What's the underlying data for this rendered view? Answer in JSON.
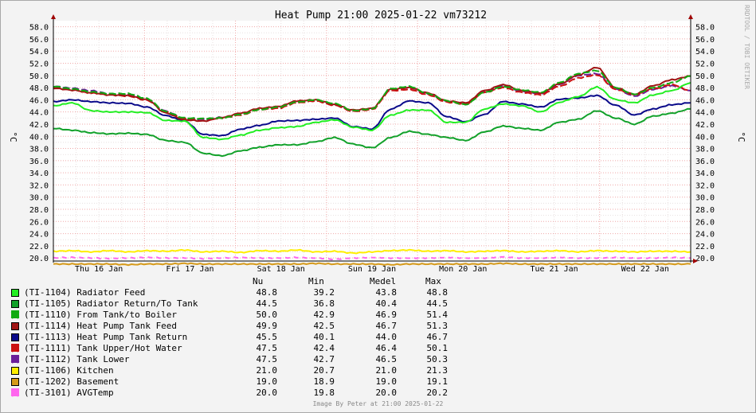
{
  "chart_data": {
    "type": "line",
    "title": "Heat Pump 21:00 2025-01-22 vm73212",
    "ylabel": "°C",
    "ylabel_right": "°C",
    "ylim": [
      19.5,
      59
    ],
    "y_ticks": [
      "58.0",
      "56.0",
      "54.0",
      "52.0",
      "50.0",
      "48.0",
      "46.0",
      "44.0",
      "42.0",
      "40.0",
      "38.0",
      "36.0",
      "34.0",
      "32.0",
      "30.0",
      "28.0",
      "26.0",
      "24.0",
      "22.0",
      "20.0"
    ],
    "x_ticks": [
      "Thu 16 Jan",
      "Fri 17 Jan",
      "Sat 18 Jan",
      "Sun 19 Jan",
      "Mon 20 Jan",
      "Tue 21 Jan",
      "Wed 22 Jan"
    ],
    "grid": true,
    "legend_placement": "bottom",
    "x": [
      0,
      6,
      12,
      18,
      24,
      30,
      36,
      42,
      48,
      54,
      60,
      66,
      72,
      78,
      84,
      90,
      96,
      102,
      108,
      114,
      120,
      126,
      132,
      138,
      144,
      150,
      156,
      162,
      168
    ],
    "series": [
      {
        "name": "(TI-1104) Radiator Feed",
        "color": "#22ee22",
        "style": "solid",
        "values": [
          45.0,
          45.5,
          44.2,
          44.0,
          44.0,
          43.9,
          42.6,
          42.5,
          39.8,
          39.5,
          40.2,
          41.0,
          41.4,
          41.6,
          42.3,
          42.7,
          41.5,
          41.0,
          43.5,
          44.3,
          44.3,
          42.3,
          42.3,
          44.5,
          45.3,
          45.0,
          44.0,
          45.6,
          46.5,
          48.1,
          46.0,
          45.5,
          46.8,
          47.5,
          48.8
        ]
      },
      {
        "name": "(TI-1105) Radiator Return/To Tank",
        "color": "#12a12a",
        "style": "solid",
        "values": [
          41.3,
          41.0,
          40.6,
          40.4,
          40.5,
          40.3,
          39.3,
          39.0,
          37.2,
          36.8,
          37.6,
          38.2,
          38.6,
          38.6,
          39.1,
          39.8,
          38.7,
          38.1,
          39.8,
          40.8,
          40.3,
          39.8,
          39.3,
          40.7,
          41.7,
          41.3,
          41.0,
          42.3,
          42.8,
          44.2,
          43.0,
          42.0,
          43.3,
          43.8,
          44.5
        ]
      },
      {
        "name": "(TI-1110) From Tank/to Boiler",
        "color": "#11aa11",
        "style": "xdash",
        "values": [
          48.2,
          47.8,
          47.3,
          47.0,
          47.0,
          46.2,
          44.0,
          43.0,
          42.9,
          43.0,
          43.6,
          44.4,
          44.8,
          45.6,
          46.0,
          45.4,
          44.2,
          44.5,
          47.8,
          48.2,
          47.0,
          45.8,
          45.2,
          47.2,
          48.2,
          47.6,
          47.2,
          48.8,
          50.3,
          50.8,
          48.0,
          46.9,
          48.0,
          48.8,
          49.9
        ]
      },
      {
        "name": "(TI-1114) Heat Pump Tank Feed",
        "color": "#a01414",
        "style": "solid",
        "values": [
          47.9,
          47.6,
          47.2,
          46.8,
          46.7,
          46.0,
          43.8,
          42.7,
          42.5,
          43.1,
          43.8,
          44.6,
          44.9,
          45.8,
          46.0,
          45.2,
          44.3,
          44.6,
          47.7,
          48.0,
          47.1,
          45.8,
          45.5,
          47.5,
          48.5,
          47.5,
          47.1,
          48.6,
          50.1,
          51.3,
          48.0,
          46.9,
          48.3,
          49.3,
          49.9
        ]
      },
      {
        "name": "(TI-1113) Heat Pump Tank Return",
        "color": "#0a0a8a",
        "style": "solid",
        "values": [
          45.7,
          46.0,
          45.7,
          45.5,
          45.4,
          44.8,
          43.4,
          42.5,
          40.3,
          40.1,
          41.2,
          41.8,
          42.5,
          42.6,
          42.8,
          43.0,
          41.6,
          41.2,
          44.5,
          45.8,
          45.5,
          43.2,
          42.4,
          43.6,
          45.7,
          45.3,
          44.8,
          46.1,
          46.3,
          46.7,
          45.1,
          43.5,
          44.5,
          45.2,
          45.5
        ]
      },
      {
        "name": "(TI-1111) Tank Upper/Hot Water",
        "color": "#cc1111",
        "style": "xdash",
        "values": [
          48.0,
          47.6,
          47.1,
          46.8,
          46.6,
          45.9,
          44.0,
          42.9,
          42.5,
          43.0,
          43.5,
          44.4,
          44.6,
          45.5,
          45.8,
          45.1,
          44.1,
          44.4,
          47.5,
          47.7,
          46.8,
          45.6,
          45.3,
          47.2,
          48.0,
          47.2,
          46.8,
          48.2,
          49.6,
          50.1,
          47.7,
          46.8,
          47.8,
          48.5,
          47.5
        ]
      },
      {
        "name": "(TI-1112) Tank Lower",
        "color": "#6a1f9a",
        "style": "xdash",
        "values": [
          48.2,
          47.9,
          47.5,
          47.0,
          46.8,
          46.1,
          44.1,
          42.9,
          42.8,
          43.1,
          43.6,
          44.5,
          44.7,
          45.6,
          45.9,
          45.2,
          44.1,
          44.5,
          47.7,
          48.0,
          46.9,
          45.7,
          45.4,
          47.3,
          48.3,
          47.4,
          47.0,
          48.5,
          50.0,
          50.3,
          47.8,
          46.6,
          47.7,
          48.3,
          47.5
        ]
      },
      {
        "name": "(TI-1106) Kitchen",
        "color": "#ffee00",
        "style": "solid",
        "values": [
          21.1,
          21.2,
          21.0,
          21.2,
          21.0,
          21.2,
          21.1,
          21.3,
          21.0,
          21.1,
          20.9,
          21.2,
          21.1,
          21.3,
          21.0,
          21.1,
          20.8,
          21.0,
          21.2,
          21.3,
          21.1,
          21.2,
          21.0,
          21.1,
          21.2,
          21.0,
          21.1,
          21.2,
          21.0,
          21.2,
          21.1,
          21.0,
          21.1,
          21.1,
          21.0
        ]
      },
      {
        "name": "(TI-1202) Basement",
        "color": "#d69a1a",
        "style": "solid",
        "values": [
          19.0,
          19.0,
          19.0,
          19.0,
          18.9,
          19.0,
          19.0,
          19.1,
          19.0,
          19.0,
          19.0,
          19.0,
          19.0,
          19.0,
          19.1,
          19.0,
          19.0,
          19.0,
          18.9,
          19.0,
          19.0,
          19.0,
          19.0,
          19.0,
          19.1,
          19.0,
          19.0,
          19.0,
          19.0,
          19.0,
          19.0,
          19.0,
          19.0,
          19.0,
          19.0
        ]
      },
      {
        "name": "(TI-3101) AVGTemp",
        "color": "#ff66ee",
        "style": "dash",
        "values": [
          20.0,
          20.1,
          20.0,
          19.9,
          20.0,
          20.1,
          20.0,
          20.0,
          19.9,
          20.0,
          20.1,
          20.0,
          20.0,
          20.1,
          20.0,
          19.8,
          20.0,
          20.1,
          20.0,
          20.0,
          20.0,
          20.1,
          20.0,
          20.0,
          20.2,
          20.0,
          20.0,
          20.1,
          20.0,
          20.0,
          20.1,
          20.0,
          20.0,
          20.1,
          20.0
        ]
      }
    ]
  },
  "legend": {
    "headers": {
      "now": "Nu",
      "min": "Min",
      "avg": "Medel",
      "max": "Max"
    },
    "rows": [
      {
        "label": "(TI-1104) Radiator Feed",
        "now": "48.8",
        "min": "39.2",
        "avg": "43.8",
        "max": "48.8",
        "color": "#22ee22",
        "marker": "square"
      },
      {
        "label": "(TI-1105) Radiator Return/To Tank",
        "now": "44.5",
        "min": "36.8",
        "avg": "40.4",
        "max": "44.5",
        "color": "#12a12a",
        "marker": "square"
      },
      {
        "label": "(TI-1110) From Tank/to Boiler",
        "now": "50.0",
        "min": "42.9",
        "avg": "46.9",
        "max": "51.4",
        "color": "#11aa11",
        "marker": "cross"
      },
      {
        "label": "(TI-1114) Heat Pump Tank Feed",
        "now": "49.9",
        "min": "42.5",
        "avg": "46.7",
        "max": "51.3",
        "color": "#a01414",
        "marker": "square"
      },
      {
        "label": "(TI-1113) Heat Pump Tank Return",
        "now": "45.5",
        "min": "40.1",
        "avg": "44.0",
        "max": "46.7",
        "color": "#0a0a8a",
        "marker": "square"
      },
      {
        "label": "(TI-1111) Tank Upper/Hot Water",
        "now": "47.5",
        "min": "42.4",
        "avg": "46.4",
        "max": "50.1",
        "color": "#cc1111",
        "marker": "cross"
      },
      {
        "label": "(TI-1112) Tank Lower",
        "now": "47.5",
        "min": "42.7",
        "avg": "46.5",
        "max": "50.3",
        "color": "#6a1f9a",
        "marker": "cross"
      },
      {
        "label": "(TI-1106) Kitchen",
        "now": "21.0",
        "min": "20.7",
        "avg": "21.0",
        "max": "21.3",
        "color": "#ffee00",
        "marker": "square"
      },
      {
        "label": "(TI-1202) Basement",
        "now": "19.0",
        "min": "18.9",
        "avg": "19.0",
        "max": "19.1",
        "color": "#d69a1a",
        "marker": "square"
      },
      {
        "label": "(TI-3101) AVGTemp",
        "now": "20.0",
        "min": "19.8",
        "avg": "20.0",
        "max": "20.2",
        "color": "#ff66ee",
        "marker": "cross"
      }
    ]
  },
  "footer": "Image By Peter at 21:00 2025-01-22",
  "watermark": "RRDTOOL / TOBI OETIKER"
}
